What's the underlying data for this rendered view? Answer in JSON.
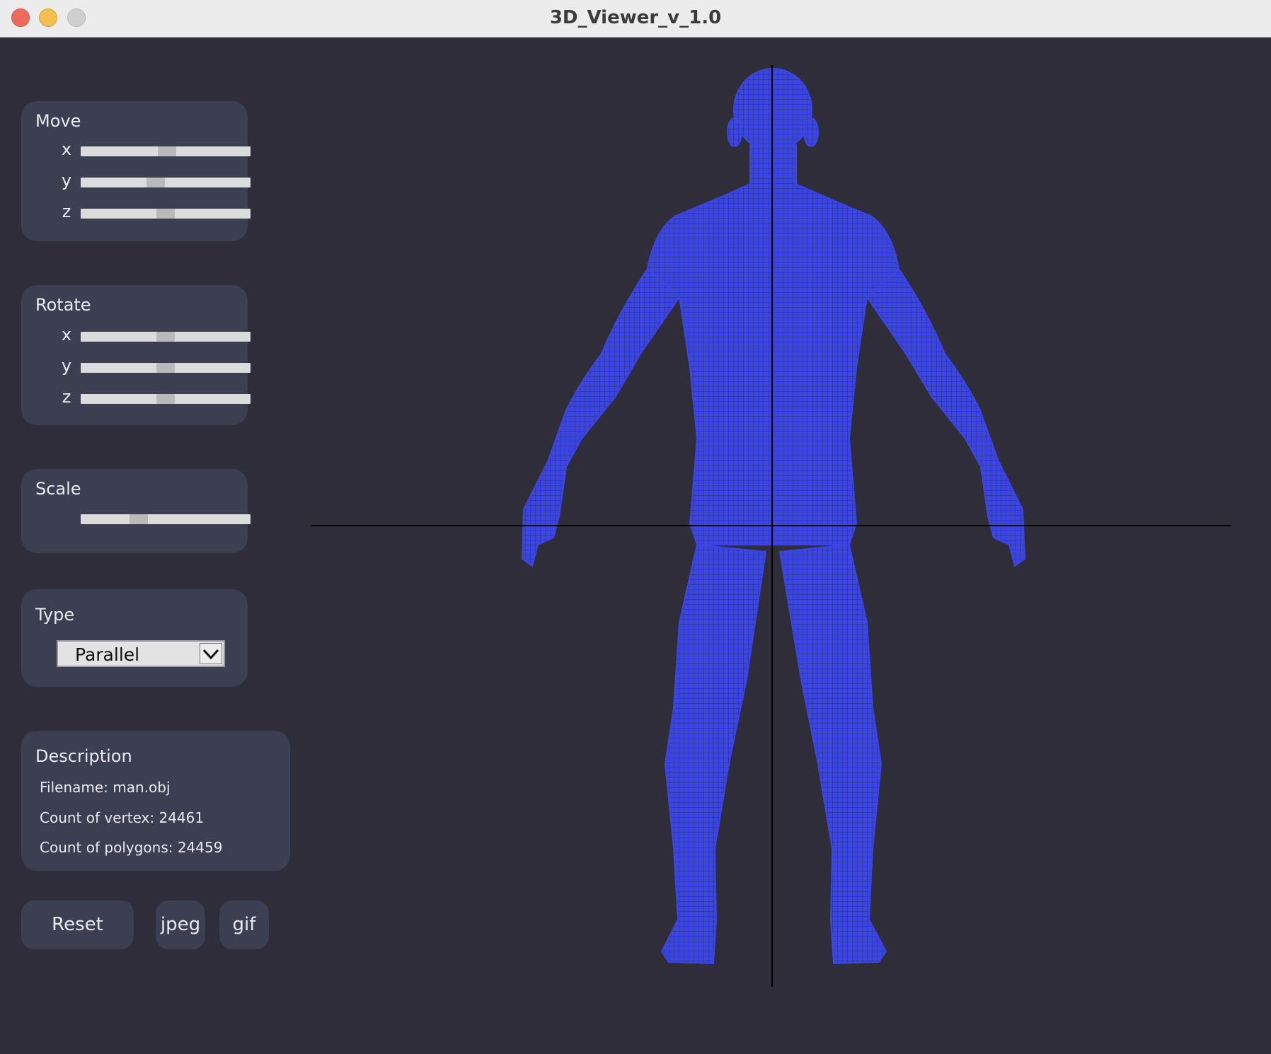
{
  "window": {
    "title": "3D_Viewer_v_1.0"
  },
  "move": {
    "title": "Move",
    "sliders": [
      {
        "axis": "x",
        "value": 0.51
      },
      {
        "axis": "y",
        "value": 0.44
      },
      {
        "axis": "z",
        "value": 0.5
      }
    ]
  },
  "rotate": {
    "title": "Rotate",
    "sliders": [
      {
        "axis": "x",
        "value": 0.5
      },
      {
        "axis": "y",
        "value": 0.5
      },
      {
        "axis": "z",
        "value": 0.5
      }
    ]
  },
  "scale": {
    "title": "Scale",
    "value": 0.34
  },
  "type": {
    "title": "Type",
    "selected": "Parallel"
  },
  "description": {
    "title": "Description",
    "filename": "Filename: man.obj",
    "vertex_count": "Count of vertex: 24461",
    "polygon_count": "Count of polygons: 24459"
  },
  "buttons": {
    "reset": "Reset",
    "jpeg": "jpeg",
    "gif": "gif"
  },
  "colors": {
    "model": "#3b45e0",
    "background": "#2f2d39",
    "panel": "#3b3f51"
  },
  "icons": {
    "dropdown": "chevron-down-icon"
  }
}
